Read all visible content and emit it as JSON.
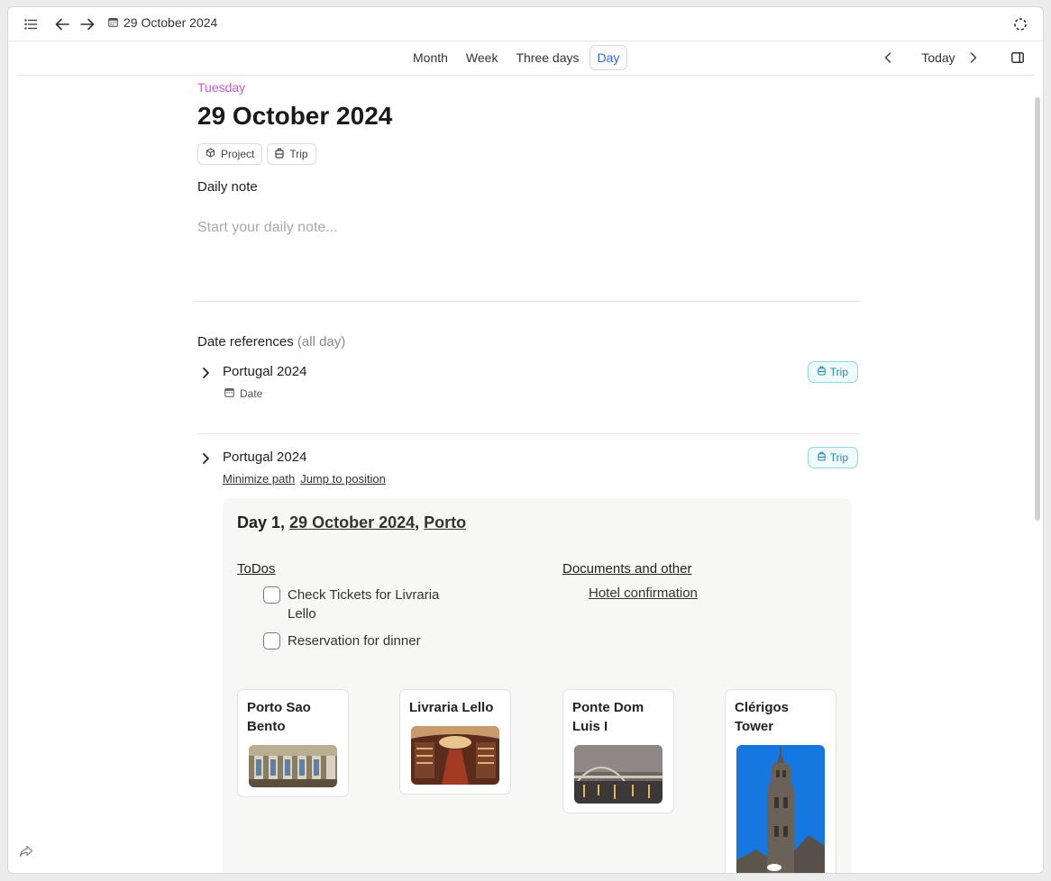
{
  "titlebar": {
    "breadcrumb": "29 October 2024",
    "icons": [
      "list-icon",
      "back-arrow-icon",
      "forward-arrow-icon",
      "calendar-icon",
      "sync-icon"
    ]
  },
  "viewbar": {
    "tabs": [
      "Month",
      "Week",
      "Three days",
      "Day"
    ],
    "active_tab": "Day",
    "today_label": "Today"
  },
  "page": {
    "weekday": "Tuesday",
    "date": "29 October 2024",
    "tags": [
      {
        "label": "Project",
        "icon": "cube-icon"
      },
      {
        "label": "Trip",
        "icon": "luggage-icon"
      }
    ],
    "daily_note_label": "Daily note",
    "daily_note_placeholder": "Start your daily note..."
  },
  "references": {
    "title": "Date references",
    "title_suffix": "(all day)",
    "items": [
      {
        "title": "Portugal 2024",
        "sub": "Date",
        "badge": "Trip"
      },
      {
        "title": "Portugal 2024",
        "badge": "Trip",
        "links": [
          "Minimize path",
          "Jump to position"
        ]
      }
    ]
  },
  "day_card": {
    "prefix": "Day 1, ",
    "date_link": "29 October 2024",
    "separator": ", ",
    "city_link": "Porto",
    "todos_heading": "ToDos",
    "todos": [
      "Check Tickets for Livraria Lello",
      "Reservation for dinner"
    ],
    "docs_heading": "Documents and other",
    "docs": [
      "Hotel confirmation"
    ],
    "places": [
      "Porto Sao Bento",
      "Livraria Lello",
      "Ponte Dom Luis I",
      "Clérigos Tower"
    ]
  },
  "colors": {
    "accent": "#3a66d8",
    "weekday": "#c657e0",
    "trip_badge": "#2b8aa6"
  }
}
